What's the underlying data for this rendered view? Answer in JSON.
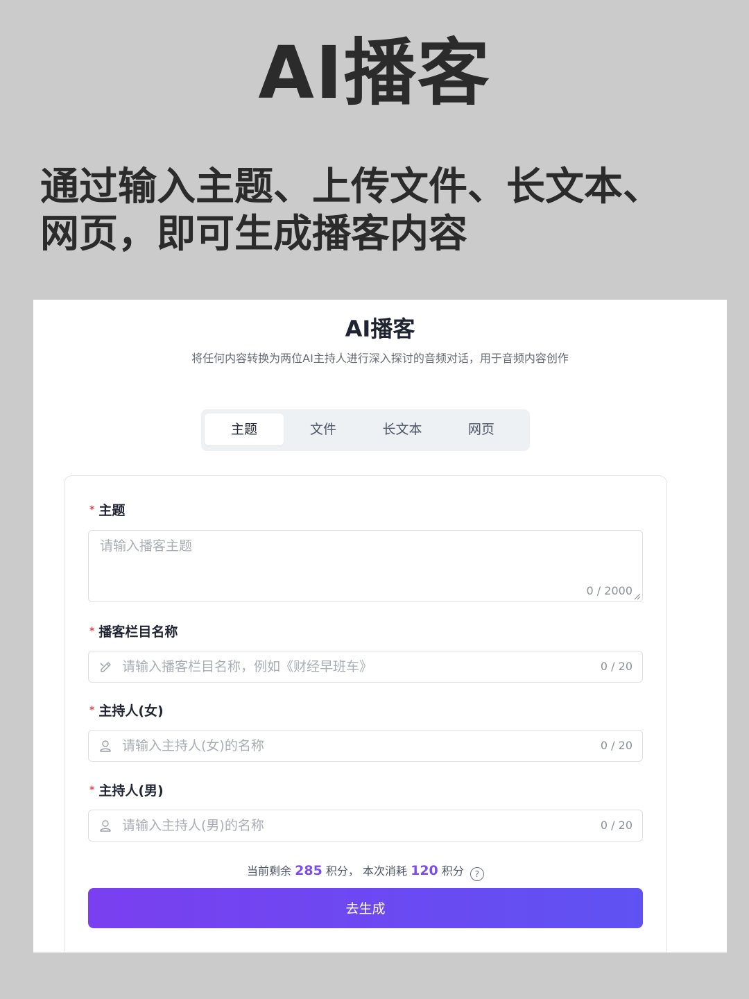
{
  "poster": {
    "title": "AI播客",
    "subtitle": "通过输入主题、上传文件、长文本、\n网页，即可生成播客内容"
  },
  "app": {
    "title": "AI播客",
    "description": "将任何内容转换为两位AI主持人进行深入探讨的音频对话，用于音频内容创作"
  },
  "tabs": [
    {
      "label": "主题",
      "active": true
    },
    {
      "label": "文件",
      "active": false
    },
    {
      "label": "长文本",
      "active": false
    },
    {
      "label": "网页",
      "active": false
    }
  ],
  "form": {
    "topic": {
      "label": "主题",
      "required_mark": "*",
      "placeholder": "请输入播客主题",
      "value": "",
      "count": "0 / 2000"
    },
    "column_name": {
      "label": "播客栏目名称",
      "required_mark": "*",
      "placeholder": "请输入播客栏目名称，例如《财经早班车》",
      "value": "",
      "count": "0 / 20",
      "icon": "pencil-icon"
    },
    "host_female": {
      "label": "主持人(女)",
      "required_mark": "*",
      "placeholder": "请输入主持人(女)的名称",
      "value": "",
      "count": "0 / 20",
      "icon": "user-icon"
    },
    "host_male": {
      "label": "主持人(男)",
      "required_mark": "*",
      "placeholder": "请输入主持人(男)的名称",
      "value": "",
      "count": "0 / 20",
      "icon": "user-icon"
    }
  },
  "points": {
    "prefix": "当前剩余",
    "remaining": "285",
    "unit1": "积分，",
    "middle": "本次消耗",
    "cost": "120",
    "unit2": "积分",
    "help": "?"
  },
  "submit_label": "去生成",
  "colors": {
    "accent": "#7a3ff0",
    "accent_end": "#5f52f3",
    "required": "#e5484d",
    "background": "#cbcbcb"
  }
}
